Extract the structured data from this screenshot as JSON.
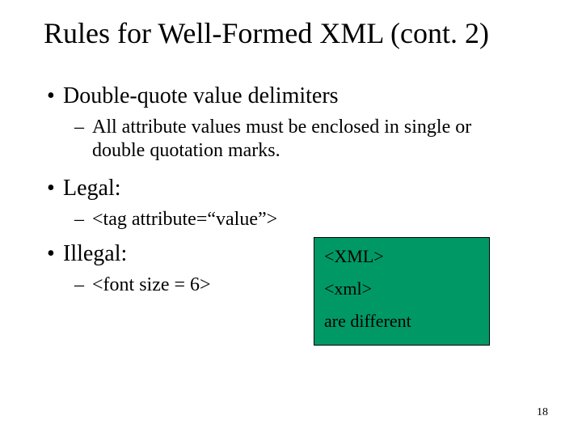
{
  "title": "Rules for Well-Formed XML (cont. 2)",
  "bullets": {
    "b1": "Double-quote value delimiters",
    "b1_sub": "All attribute values must be enclosed in single or double quotation marks.",
    "b2": "Legal:",
    "b2_sub": "<tag attribute=“value”>",
    "b3": "Illegal:",
    "b3_sub": "<font size = 6>"
  },
  "callout": {
    "line1": "<XML>",
    "line2": "<xml>",
    "line3": "are different"
  },
  "page_number": "18"
}
